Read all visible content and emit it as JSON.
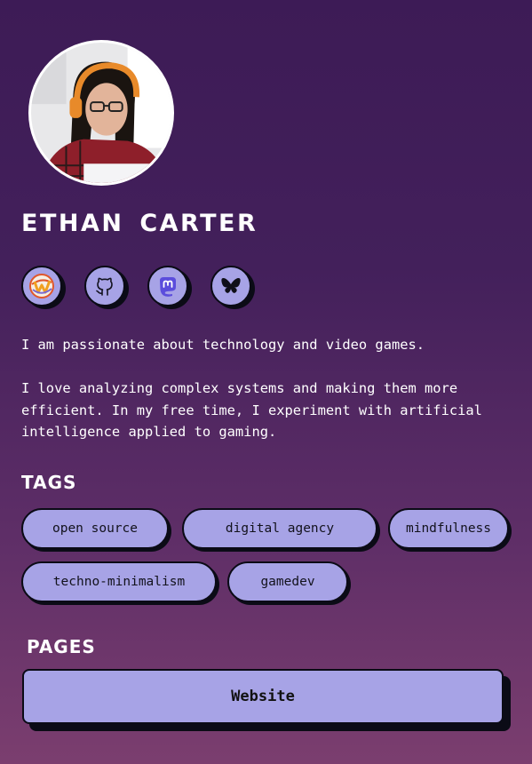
{
  "profile": {
    "name": "ETHAN CARTER",
    "avatar_icon": "person-with-headphones-photo"
  },
  "socials": [
    {
      "name": "wishlist-w-icon"
    },
    {
      "name": "github-icon"
    },
    {
      "name": "mastodon-icon"
    },
    {
      "name": "bluesky-icon"
    }
  ],
  "bio": {
    "line1": "I am passionate about technology and video games.",
    "line2": "I love analyzing complex systems and making them more efficient. In my free time, I experiment with artificial intelligence applied to gaming."
  },
  "tags": {
    "title": "TAGS",
    "items": [
      "open source",
      "digital agency",
      "mindfulness",
      "techno-minimalism",
      "gamedev"
    ]
  },
  "pages": {
    "title": "PAGES",
    "items": [
      "Website"
    ]
  },
  "colors": {
    "background_top": "#3d1b56",
    "background_bottom": "#7b3e6f",
    "accent": "#a7a3e6",
    "outline": "#0b0b16"
  }
}
